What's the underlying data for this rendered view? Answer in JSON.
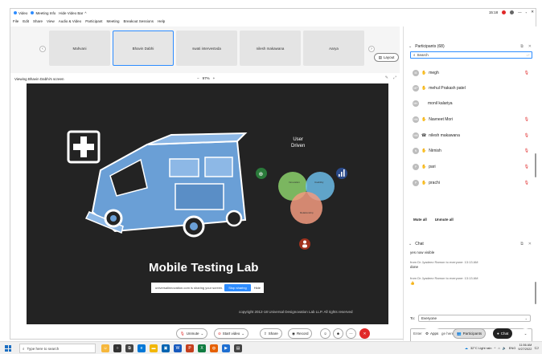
{
  "titlebar": {
    "items": [
      "Video",
      "Meeting Info",
      "Hide Video Bar"
    ],
    "time": "15:18"
  },
  "menu": [
    "File",
    "Edit",
    "Share",
    "View",
    "Audio & Video",
    "Participant",
    "Meeting",
    "Breakout Sessions",
    "Help"
  ],
  "gallery": {
    "tiles": [
      {
        "name": "Mahvani"
      },
      {
        "name": "Bhavin Dabhi",
        "active": true
      },
      {
        "name": "swati intervestvda"
      },
      {
        "name": "nilesh makawana"
      },
      {
        "name": "Aarya"
      }
    ],
    "layout_label": "Layout"
  },
  "viewbar": {
    "viewing": "Viewing Bhavin Dabhi's screen",
    "zoom_minus": "−",
    "zoom": "97%",
    "zoom_plus": "+"
  },
  "share": {
    "title": "Mobile Testing Lab",
    "user_driven": [
      "User",
      "Driven"
    ],
    "venn_labels": [
      "Innovation",
      "Usability",
      "Relationship"
    ],
    "copyright": "copyright  2012-18 Universal Designovation Lab LLP. All rights reserved",
    "sharing_text": "universalinnovation.com is sharing your screen.",
    "stop_label": "Stop sharing",
    "hide_label": "Hide"
  },
  "participants": {
    "header": "Participants (68)",
    "search_value": "Search",
    "list": [
      {
        "initials": "M",
        "name": "megh",
        "hand": true,
        "muted": true
      },
      {
        "initials": "MP",
        "name": "mehul Prakash patel",
        "hand": true,
        "muted": false
      },
      {
        "initials": "MK",
        "name": "monil kalariya",
        "hand": false,
        "muted": false
      },
      {
        "initials": "NM",
        "name": "Navneet Mori",
        "hand": true,
        "muted": true
      },
      {
        "initials": "NM",
        "name": "nilesh makawana",
        "hand": false,
        "muted": true
      },
      {
        "initials": "N",
        "name": "Nirnish",
        "hand": true,
        "muted": true
      },
      {
        "initials": "P",
        "name": "pari",
        "hand": true,
        "muted": true
      },
      {
        "initials": "P",
        "name": "prachi",
        "hand": true,
        "muted": true
      }
    ],
    "mute_all": "Mute all",
    "unmute_all": "Unmute all"
  },
  "chat": {
    "header": "Chat",
    "messages": [
      {
        "from": "",
        "text": "yes now visible"
      },
      {
        "from": "from Dr Jyadeez Ramon  to everyone:  13:13 AM",
        "text": "done"
      },
      {
        "from": "from Dr Jyadeez Ramon  to everyone:  13:13 AM",
        "text": "👍"
      }
    ],
    "to_label": "To:",
    "to_value": "Everyone",
    "input_placeholder": "Enter chat message here"
  },
  "toolbar": {
    "unmute": "Unmute",
    "start_video": "Start video",
    "share": "Share",
    "record": "Record",
    "apps": "Apps",
    "participants": "Participants",
    "chat": "Chat"
  },
  "taskbar": {
    "search_placeholder": "Type here to search",
    "weather": "32°C  Light rain",
    "lang": "ENG",
    "time": "11:56 AM",
    "date": "9/27/2022"
  },
  "colors": {
    "accent": "#2d8cff",
    "danger": "#e02828",
    "share_bg": "#232323",
    "van": "#6a9fd6"
  }
}
